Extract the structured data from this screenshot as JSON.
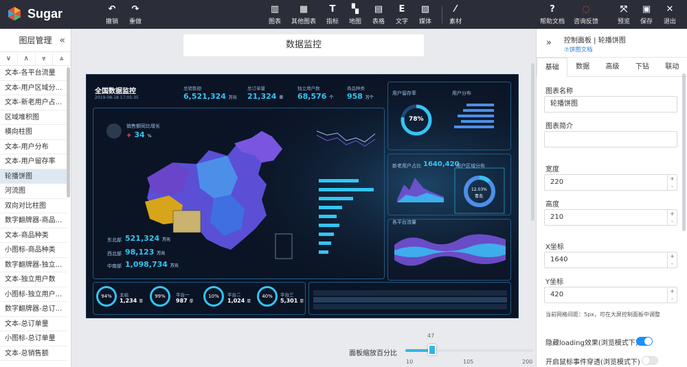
{
  "app": {
    "name": "Sugar"
  },
  "toolbar": {
    "undo": "撤销",
    "redo": "重做",
    "chart": "图表",
    "other_chart": "其他图表",
    "metric": "指标",
    "map": "地图",
    "table": "表格",
    "text": "文字",
    "media": "媒体",
    "material": "素材",
    "help": "帮助文档",
    "feedback": "咨询反馈",
    "preview": "预览",
    "save": "保存",
    "exit": "退出"
  },
  "layers": {
    "title": "图层管理",
    "items": [
      "文本-各平台流量",
      "文本-用户区域分...",
      "文本-新老用户占...",
      "区域堆积图",
      "横向柱图",
      "文本-用户分布",
      "文本-用户留存率",
      "轮播饼图",
      "河流图",
      "双向对比柱图",
      "数字翻牌器-商品...",
      "文本-商品种类",
      "小图标-商品种类",
      "数字翻牌器-独立...",
      "文本-独立用户数",
      "小图标-独立用户...",
      "数字翻牌器-总订...",
      "文本-总订单量",
      "小图标-总订单量",
      "文本-总销售额"
    ],
    "active_index": 7
  },
  "canvas": {
    "page_title": "数据监控",
    "screen": {
      "title": "全国数据监控",
      "date": "2019-08-18 17:05:35",
      "kpis": [
        {
          "label": "总销售额",
          "value": "6,521,324",
          "unit": "万元"
        },
        {
          "label": "总订单量",
          "value": "21,324",
          "unit": "单"
        },
        {
          "label": "独立用户数",
          "value": "68,576",
          "unit": "个"
        },
        {
          "label": "商品种类",
          "value": "958",
          "unit": "万个"
        }
      ],
      "growth_label": "销售额同比增长",
      "growth_value": "34",
      "growth_unit": "%",
      "regions": [
        {
          "label": "东北部",
          "value": "521,324",
          "unit": "万元"
        },
        {
          "label": "西北部",
          "value": "98,123",
          "unit": "万元"
        },
        {
          "label": "中南部",
          "value": "1,098,734",
          "unit": "万元"
        }
      ],
      "gauges": [
        {
          "pct": "94%",
          "label": "主站",
          "value": "1,234",
          "unit": "单"
        },
        {
          "pct": "99%",
          "label": "平台一",
          "value": "987",
          "unit": "单"
        },
        {
          "pct": "10%",
          "label": "平台二",
          "value": "1,024",
          "unit": "单"
        },
        {
          "pct": "40%",
          "label": "平台三",
          "value": "5,301",
          "unit": "单"
        }
      ],
      "retention_title": "用户留存率",
      "retention_pct": "78%",
      "distribution_title": "用户分布",
      "new_user_title": "新老用户占比",
      "new_user_value": "1640,420",
      "region_dist_title": "用户区域分布",
      "pie_pct": "12.03%",
      "pie_label": "青岛",
      "traffic_title": "各平台流量"
    },
    "zoom": {
      "label": "面板缩放百分比",
      "value": "47",
      "min": "10",
      "mid": "105",
      "max": "200"
    }
  },
  "right_panel": {
    "title": "控制面板 | 轮播饼图",
    "doc_link": "⑦饼图文档",
    "tabs": [
      "基础",
      "数据",
      "高级",
      "下钻",
      "联动"
    ],
    "active_tab": 0,
    "chart_name_label": "图表名称",
    "chart_name_value": "轮播饼图",
    "chart_desc_label": "图表简介",
    "chart_desc_value": "",
    "width_label": "宽度",
    "width_value": "220",
    "height_label": "高度",
    "height_value": "210",
    "x_label": "X坐标",
    "x_value": "1640",
    "y_label": "Y坐标",
    "y_value": "420",
    "grid_hint": "当前网格间距：5px，可在大屏控制面板中调整",
    "hide_loading_label": "隐藏loading效果(浏览模式下)",
    "hide_loading_on": true,
    "mouse_through_label": "开启鼠标事件穿透(浏览模式下)",
    "mouse_through_on": false
  },
  "colors": {
    "topbar": "#2b2e38",
    "accent": "#1890ff",
    "screen_bg": "#0b1425",
    "cyan": "#33c5f5"
  }
}
